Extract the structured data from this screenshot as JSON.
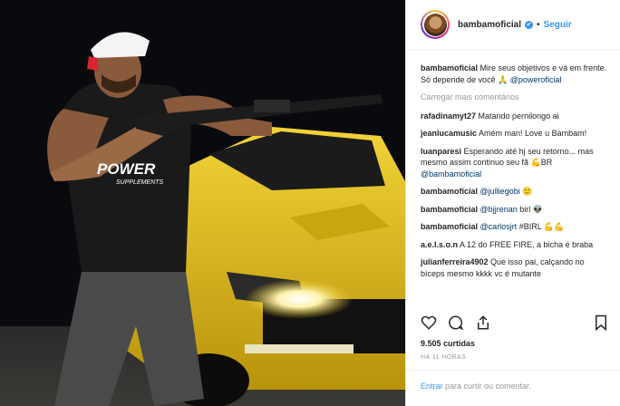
{
  "header": {
    "username": "bambamoficial",
    "verified_badge": "✔",
    "separator": "•",
    "follow_label": "Seguir"
  },
  "caption": {
    "username": "bambamoficial",
    "text": " Mire seus objetivos e vá em frente. Só depende de você 🙏 ",
    "mention": "@poweroficial"
  },
  "load_more": "Carregar mais comentários",
  "comments": [
    {
      "user": "rafadinamyt27",
      "text": " Matando pernilongo ai",
      "mention": ""
    },
    {
      "user": "jeanlucamusic",
      "text": " Amém man! Love u Bambam!",
      "mention": ""
    },
    {
      "user": "luanparesi",
      "text": " Esperando até hj seu retorno... mas mesmo assim continuo seu fã 💪BR ",
      "mention": "@bambamoficial"
    },
    {
      "user": "bambamoficial",
      "text": " 🙂",
      "mention": "@julliegobi"
    },
    {
      "user": "bambamoficial",
      "text": " birl 👽",
      "mention": "@bjjrenan"
    },
    {
      "user": "bambamoficial",
      "text": " #BIRL 💪💪",
      "mention": "@carlosjrt"
    },
    {
      "user": "a.e.l.s.o.n",
      "text": " A 12 do FREE FIRE, a bicha é braba",
      "mention": ""
    },
    {
      "user": "julianferreira4902",
      "text": " Que isso pai, calçando no bíceps mesmo kkkk vc é mutante",
      "mention": ""
    }
  ],
  "icons": {
    "like": "heart-icon",
    "comment": "comment-icon",
    "share": "share-icon",
    "save": "bookmark-icon"
  },
  "likes_text": "9.505 curtidas",
  "date_text": "HÁ 11 HORAS",
  "login_prompt": {
    "link": "Entrar",
    "text": " para curtir ou comentar."
  },
  "photo": {
    "cap_brand": "",
    "shirt_brand_line1": "POWER",
    "shirt_brand_line2": "SUPPLEMENTS"
  },
  "colors": {
    "link_blue": "#3897f0",
    "mention_blue": "#003569",
    "car_yellow": "#e8c21a"
  }
}
